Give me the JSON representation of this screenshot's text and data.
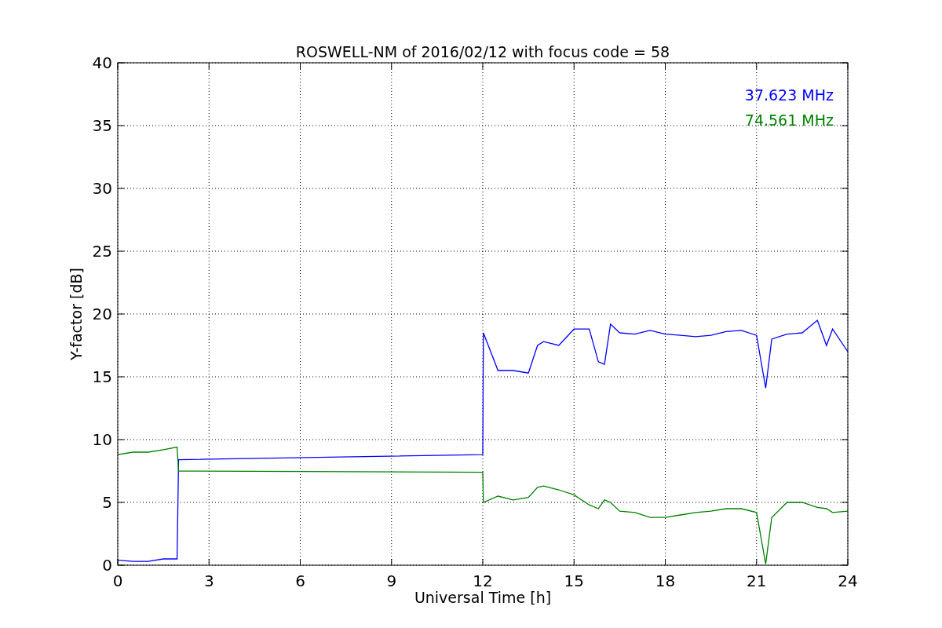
{
  "chart_data": {
    "type": "line",
    "title": "ROSWELL-NM of 2016/02/12 with focus code = 58",
    "xlabel": "Universal Time [h]",
    "ylabel": "Y-factor [dB]",
    "x": [
      0,
      0.5,
      1,
      1.5,
      1.95,
      2,
      12,
      12.02,
      12.5,
      13,
      13.5,
      13.8,
      14,
      14.5,
      15,
      15.5,
      15.8,
      16,
      16.2,
      16.5,
      17,
      17.5,
      18,
      18.5,
      19,
      19.5,
      20,
      20.5,
      21,
      21.3,
      21.5,
      22,
      22.5,
      23,
      23.3,
      23.5,
      24
    ],
    "series": [
      {
        "name": "37.623 MHz",
        "color": "#0000ff",
        "values": [
          0.4,
          0.3,
          0.3,
          0.5,
          0.5,
          8.4,
          8.8,
          18.5,
          15.5,
          15.5,
          15.3,
          17.5,
          17.8,
          17.5,
          18.8,
          18.8,
          16.2,
          16.0,
          19.2,
          18.5,
          18.4,
          18.7,
          18.4,
          18.3,
          18.2,
          18.3,
          18.6,
          18.7,
          18.3,
          14.1,
          18.0,
          18.4,
          18.5,
          19.5,
          17.5,
          18.8,
          17.0
        ]
      },
      {
        "name": "74.561 MHz",
        "color": "#008000",
        "values": [
          8.8,
          9.0,
          9.0,
          9.2,
          9.4,
          7.5,
          7.4,
          5.0,
          5.5,
          5.2,
          5.4,
          6.2,
          6.3,
          6.0,
          5.6,
          4.8,
          4.5,
          5.2,
          5.0,
          4.3,
          4.2,
          3.8,
          3.8,
          4.0,
          4.2,
          4.3,
          4.5,
          4.5,
          4.2,
          0.1,
          3.8,
          5.0,
          5.0,
          4.6,
          4.5,
          4.2,
          4.3
        ]
      }
    ],
    "grid": true,
    "xlim": [
      0,
      24
    ],
    "ylim": [
      0,
      40
    ],
    "xticks": [
      0,
      3,
      6,
      9,
      12,
      15,
      18,
      21,
      24
    ],
    "yticks": [
      0,
      5,
      10,
      15,
      20,
      25,
      30,
      35,
      40
    ]
  }
}
